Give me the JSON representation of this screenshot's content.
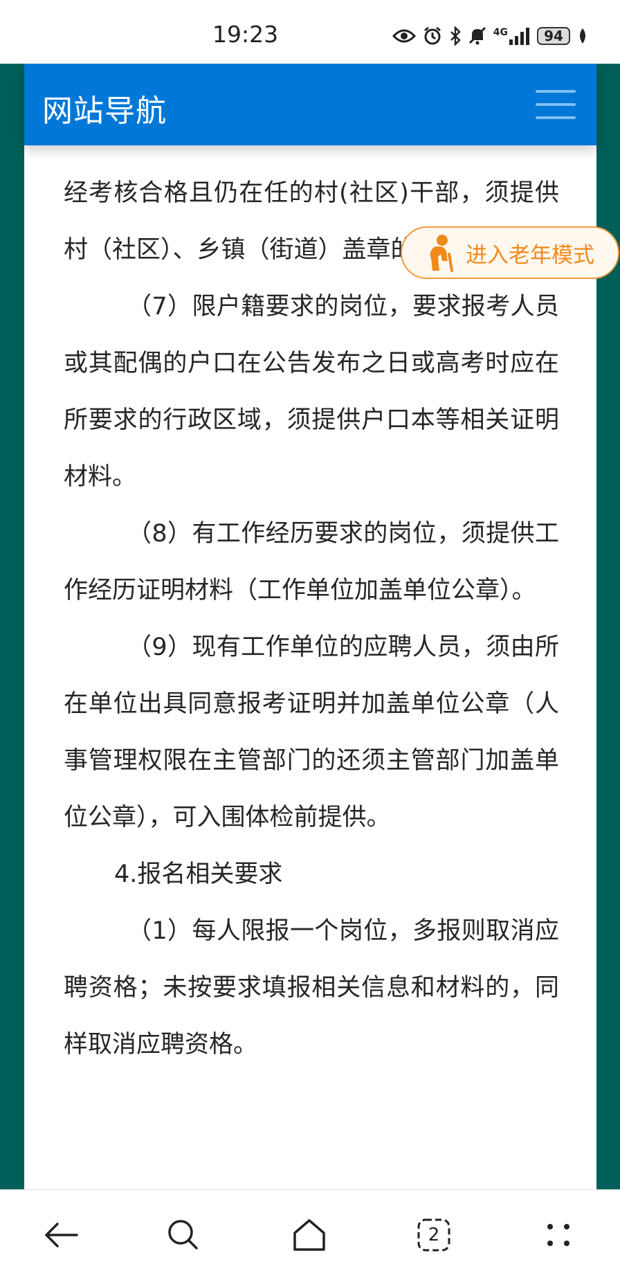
{
  "status_bar": {
    "time": "19:23",
    "network": "4G",
    "battery": "94",
    "icons": [
      "eye-icon",
      "alarm-icon",
      "bluetooth-icon",
      "mute-icon",
      "signal-icon",
      "battery-icon",
      "leaf-icon"
    ]
  },
  "header": {
    "title": "网站导航",
    "menu_icon": "menu-icon"
  },
  "elder_mode": {
    "label": "进入老年模式",
    "icon": "elderly-person-icon"
  },
  "article": {
    "paragraphs": [
      "经考核合格且仍在任的村(社区)干部，须提供村（社区）、乡镇（街道）盖章的证明材料。",
      "（7）限户籍要求的岗位，要求报考人员或其配偶的户口在公告发布之日或高考时应在所要求的行政区域，须提供户口本等相关证明材料。",
      "（8）有工作经历要求的岗位，须提供工作经历证明材料（工作单位加盖单位公章）。",
      "（9）现有工作单位的应聘人员，须由所在单位出具同意报考证明并加盖单位公章（人事管理权限在主管部门的还须主管部门加盖单位公章），可入围体检前提供。",
      "4.报名相关要求",
      "（1）每人限报一个岗位，多报则取消应聘资格；未按要求填报相关信息和材料的，同样取消应聘资格。"
    ]
  },
  "bottom_bar": {
    "tab_count": "2",
    "icons": [
      "back-arrow-icon",
      "search-icon",
      "home-icon",
      "tabs-icon",
      "more-icon"
    ]
  },
  "colors": {
    "header_blue": "#0178d8",
    "frame_green": "#005f59",
    "elder_orange": "#f08a1c"
  }
}
